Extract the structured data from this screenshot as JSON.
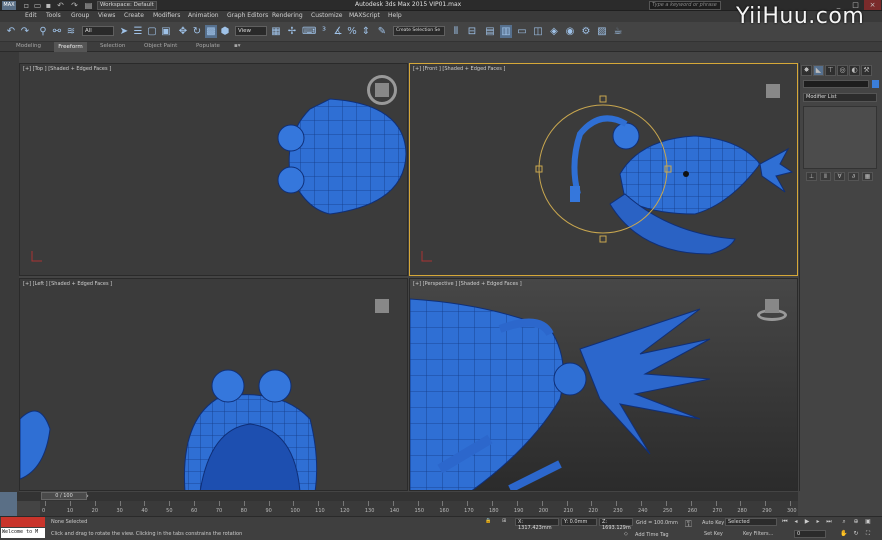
{
  "window": {
    "logo": "MAX",
    "workspace": "Workspace: Default",
    "title": "Autodesk 3ds Max 2015    VIP01.max",
    "search_placeholder": "Type a keyword or phrase"
  },
  "menu": [
    "Edit",
    "Tools",
    "Group",
    "Views",
    "Create",
    "Modifiers",
    "Animation",
    "Graph Editors",
    "Rendering",
    "Customize",
    "MAXScript",
    "Help"
  ],
  "toolbar": {
    "selection_filter": "All",
    "reference_coord": "View",
    "named_selection": "Create Selection Se"
  },
  "ribbon_tabs": [
    "Modeling",
    "Freeform",
    "Selection",
    "Object Paint",
    "Populate"
  ],
  "viewports": {
    "top": "[+] [Top ] [Shaded + Edged Faces ]",
    "front": "[+] [Front ] [Shaded + Edged Faces ]",
    "left": "[+] [Left ] [Shaded + Edged Faces ]",
    "perspective": "[+] [Perspective ] [Shaded + Edged Faces ]"
  },
  "command_panel": {
    "modifier_list": "Modifier List"
  },
  "timeline": {
    "frame": "0 / 100",
    "ticks": [
      "0",
      "10",
      "20",
      "30",
      "40",
      "50",
      "60",
      "70",
      "80",
      "90",
      "100",
      "110",
      "120",
      "130",
      "140",
      "150",
      "160",
      "170",
      "180",
      "190",
      "200",
      "210",
      "220",
      "230",
      "240",
      "250",
      "260",
      "270",
      "280",
      "290",
      "300"
    ]
  },
  "status": {
    "maxscript": "Welcome to M",
    "selection": "None Selected",
    "prompt": "Click and drag to rotate the view.  Clicking in the tabs constrains the rotation",
    "x": "X: 1317.423mm",
    "y": "Y: 0.0mm",
    "z": "Z: 1693.129m",
    "grid": "Grid = 100.0mm",
    "add_time_tag": "Add Time Tag",
    "auto_key": "Auto Key",
    "set_key": "Set Key",
    "selected": "Selected",
    "key_filters": "Key Filters...",
    "current_frame": "0"
  },
  "watermark": "YiiHuu.com",
  "colors": {
    "model_blue": "#2f6fd4",
    "viewport_bg": "#3b3b3b",
    "active_border": "#d6a838"
  }
}
